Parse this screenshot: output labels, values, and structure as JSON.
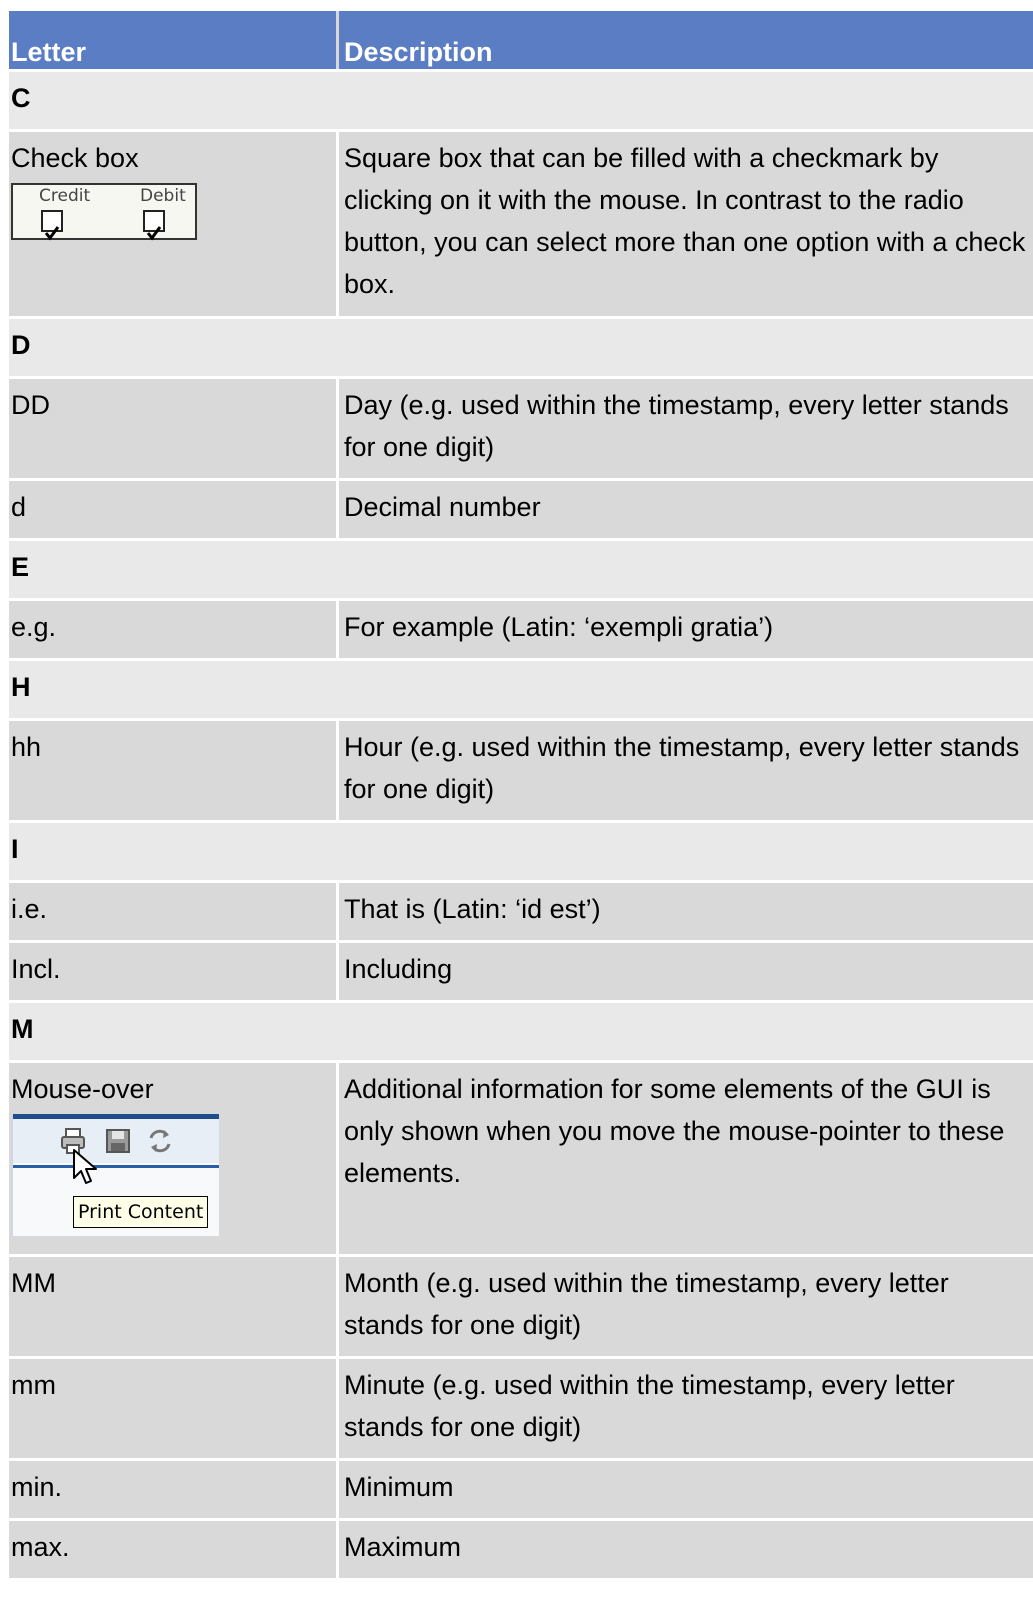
{
  "table": {
    "header": {
      "letter": "Letter",
      "description": "Description"
    },
    "sections": {
      "c": "C",
      "d": "D",
      "e": "E",
      "h": "H",
      "i": "I",
      "m": "M"
    },
    "rows": {
      "checkbox": {
        "term": "Check box",
        "description": "Square box that can be filled with a checkmark by clicking on it with the mouse. In contrast to the radio button, you can select more than one option with a check box.",
        "illustration": {
          "credit_label": "Credit",
          "debit_label": "Debit"
        }
      },
      "dd": {
        "term": "DD",
        "description": "Day (e.g. used within the timestamp, every letter stands for one digit)"
      },
      "d": {
        "term": "d",
        "description": "Decimal number"
      },
      "eg": {
        "term": "e.g.",
        "description": "For example (Latin: ‘exempli gratia’)"
      },
      "hh": {
        "term": "hh",
        "description": "Hour (e.g. used within the timestamp, every letter stands for one digit)"
      },
      "ie": {
        "term": "i.e.",
        "description": "That is (Latin: ‘id est’)"
      },
      "incl": {
        "term": "Incl.",
        "description": "Including"
      },
      "mouseover": {
        "term": "Mouse-over",
        "description": "Additional information for some elements of the GUI is only shown when you move the mouse-pointer to these elements.",
        "illustration": {
          "tooltip": "Print Content"
        }
      },
      "mm_month": {
        "term": "MM",
        "description": "Month (e.g. used within the timestamp, every letter stands for one digit)"
      },
      "mm_minute": {
        "term": "mm",
        "description": "Minute (e.g. used within the timestamp, every letter stands for one digit)"
      },
      "min": {
        "term": "min.",
        "description": "Minimum"
      },
      "max": {
        "term": "max.",
        "description": "Maximum"
      }
    }
  },
  "colors": {
    "header_bg": "#5a7dc4",
    "section_bg": "#e9e9ea",
    "row_bg": "#d9d9da"
  }
}
